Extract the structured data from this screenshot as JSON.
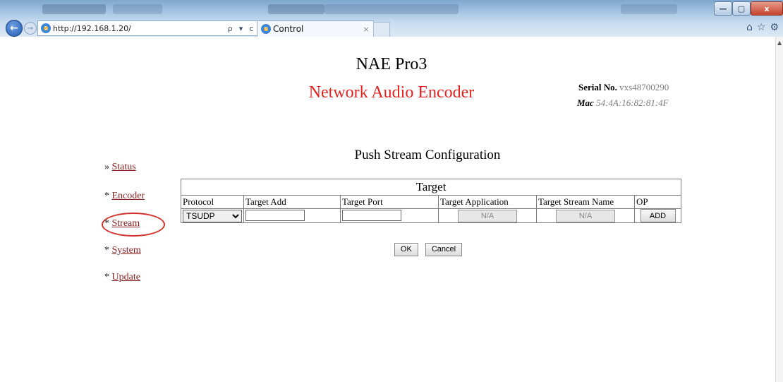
{
  "browser": {
    "url": "http://192.168.1.20/",
    "tab_label": "Control",
    "tab_close": "×",
    "minimize": "—",
    "restore": "▢",
    "close": "x",
    "search": "ρ",
    "refresh": "c",
    "dropdown": "▾"
  },
  "header": {
    "title": "NAE Pro3",
    "subtitle": "Network Audio Encoder",
    "serial_label": "Serial No.",
    "serial_value": "vxs48700290",
    "mac_label": "Mac",
    "mac_value": "54:4A:16:82:81:4F"
  },
  "nav": [
    {
      "prefix": "»",
      "label": "Status"
    },
    {
      "prefix": "*",
      "label": "Encoder"
    },
    {
      "prefix": "*",
      "label": "Stream"
    },
    {
      "prefix": "*",
      "label": "System"
    },
    {
      "prefix": "*",
      "label": "Update"
    }
  ],
  "section": {
    "title": "Push Stream Configuration"
  },
  "table": {
    "heading": "Target",
    "columns": [
      "Protocol",
      "Target Add",
      "Target Port",
      "Target Application",
      "Target Stream Name",
      "OP"
    ],
    "row": {
      "protocol": "TSUDP",
      "target_add": "",
      "target_port": "",
      "target_application": "N/A",
      "target_stream_name": "N/A",
      "op": "ADD"
    }
  },
  "actions": {
    "ok": "OK",
    "cancel": "Cancel"
  }
}
